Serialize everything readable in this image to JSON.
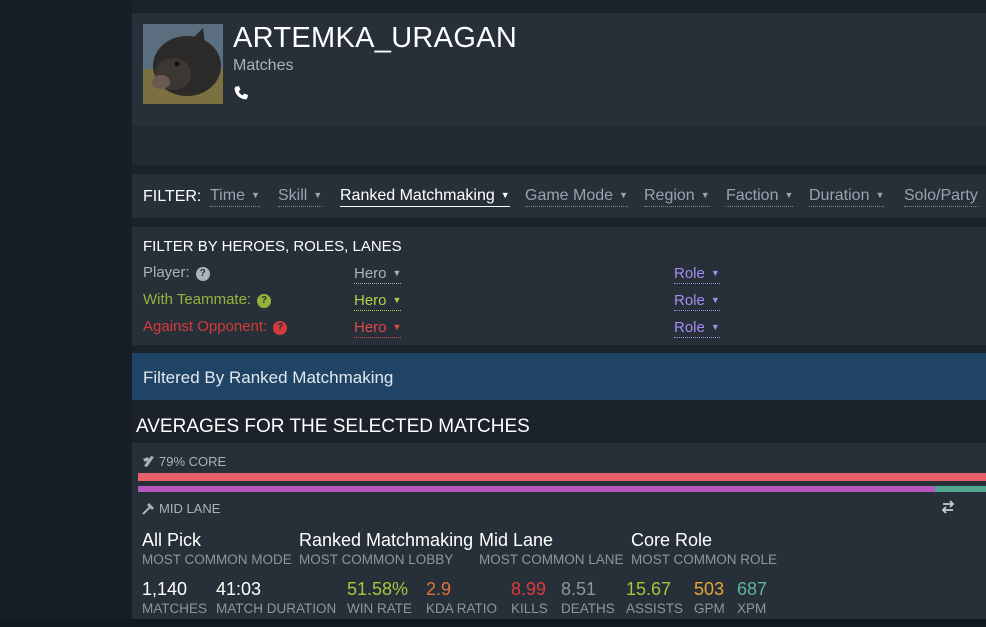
{
  "player": {
    "name": "ARTEMKA_URAGAN",
    "subtitle": "Matches"
  },
  "filter": {
    "label": "FILTER:",
    "items": [
      {
        "label": "Time",
        "active": false
      },
      {
        "label": "Skill",
        "active": false
      },
      {
        "label": "Ranked Matchmaking",
        "active": true
      },
      {
        "label": "Game Mode",
        "active": false
      },
      {
        "label": "Region",
        "active": false
      },
      {
        "label": "Faction",
        "active": false
      },
      {
        "label": "Duration",
        "active": false
      },
      {
        "label": "Solo/Party",
        "active": false
      }
    ]
  },
  "heroes_filter": {
    "title": "FILTER BY HEROES, ROLES, LANES",
    "rows": [
      {
        "label": "Player:",
        "color": "#aab2bb",
        "hero": "Hero",
        "hero_color": "#aab2bb",
        "role": "Role",
        "role_color": "#a48cf0"
      },
      {
        "label": "With Teammate:",
        "color": "#97b23a",
        "hero": "Hero",
        "hero_color": "#b5cf4b",
        "role": "Role",
        "role_color": "#a48cf0"
      },
      {
        "label": "Against Opponent:",
        "color": "#d63a3a",
        "hero": "Hero",
        "hero_color": "#e04848",
        "role": "Role",
        "role_color": "#a48cf0"
      }
    ]
  },
  "banner": {
    "text": "Filtered By Ranked Matchmaking"
  },
  "averages": {
    "title": "AVERAGES FOR THE SELECTED MATCHES",
    "core_label": "79% CORE",
    "core_fraction": 1.0,
    "lane_label": "MID LANE",
    "lane_fraction": 0.94,
    "common": [
      {
        "value": "All Pick",
        "label": "MOST COMMON MODE"
      },
      {
        "value": "Ranked Matchmaking",
        "label": "MOST COMMON LOBBY"
      },
      {
        "value": "Mid Lane",
        "label": "MOST COMMON LANE"
      },
      {
        "value": "Core Role",
        "label": "MOST COMMON ROLE"
      }
    ],
    "stats": [
      {
        "value": "1,140",
        "label": "MATCHES",
        "color": "#ffffff"
      },
      {
        "value": "41:03",
        "label": "MATCH DURATION",
        "color": "#ffffff"
      },
      {
        "value": "51.58%",
        "label": "WIN RATE",
        "color": "#a2c73d"
      },
      {
        "value": "2.9",
        "label": "KDA RATIO",
        "color": "#e0733a"
      },
      {
        "value": "8.99",
        "label": "KILLS",
        "color": "#e03a3a"
      },
      {
        "value": "8.51",
        "label": "DEATHS",
        "color": "#8d969f"
      },
      {
        "value": "15.67",
        "label": "ASSISTS",
        "color": "#a2c73d"
      },
      {
        "value": "503",
        "label": "GPM",
        "color": "#e8a531"
      },
      {
        "value": "687",
        "label": "XPM",
        "color": "#5fb29a"
      }
    ]
  }
}
